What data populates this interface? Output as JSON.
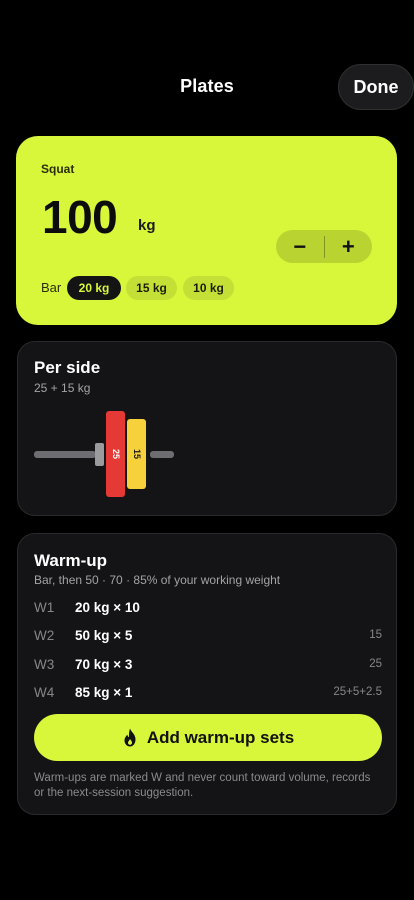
{
  "header": {
    "title": "Plates",
    "done_label": "Done"
  },
  "hero": {
    "exercise": "Squat",
    "weight": "100",
    "unit": "kg",
    "stepper": {
      "minus": "−",
      "plus": "+"
    },
    "bar_label": "Bar",
    "bar_options": [
      {
        "label": "20 kg",
        "selected": true
      },
      {
        "label": "15 kg",
        "selected": false
      },
      {
        "label": "10 kg",
        "selected": false
      }
    ],
    "accent_color": "#d9f73a"
  },
  "per_side": {
    "title": "Per side",
    "subtitle": "25 + 15 kg",
    "plates": [
      {
        "label": "25",
        "color": "#e53935"
      },
      {
        "label": "15",
        "color": "#f7d13c"
      }
    ]
  },
  "warmup": {
    "title": "Warm-up",
    "subtitle": "Bar, then 50 · 70 · 85% of your working weight",
    "rows": [
      {
        "label": "W1",
        "value": "20 kg × 10",
        "plates": ""
      },
      {
        "label": "W2",
        "value": "50 kg × 5",
        "plates": "15"
      },
      {
        "label": "W3",
        "value": "70 kg × 3",
        "plates": "25"
      },
      {
        "label": "W4",
        "value": "85 kg × 1",
        "plates": "25+5+2.5"
      }
    ],
    "add_button": "Add warm-up sets",
    "add_icon": "flame-icon",
    "footnote": "Warm-ups are marked W and never count toward volume, records or the next-session suggestion."
  }
}
